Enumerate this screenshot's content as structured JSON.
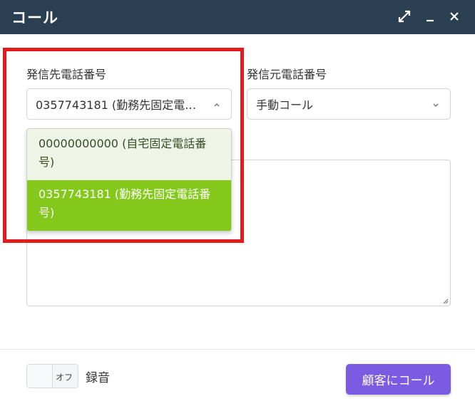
{
  "window": {
    "title": "コール",
    "icons": {
      "expand": "expand-icon",
      "minimize": "minimize-icon",
      "close": "close-icon"
    }
  },
  "destination": {
    "label": "発信先電話番号",
    "selected": "0357743181 (勤務先固定電話番号)",
    "options": [
      {
        "label": "00000000000 (自宅固定電話番号)",
        "selected": false
      },
      {
        "label": "0357743181 (勤務先固定電話番号)",
        "selected": true
      }
    ],
    "expanded": true
  },
  "source": {
    "label": "発信元電話番号",
    "selected": "手動コール"
  },
  "footer": {
    "toggle_state": "オフ",
    "record_label": "録音",
    "call_button": "顧客にコール"
  },
  "colors": {
    "titlebar": "#2b3f53",
    "selected_option": "#84c81c",
    "option_background": "#eef5e6",
    "call_button": "#7c5be3",
    "highlight_box": "#e21c1c"
  }
}
